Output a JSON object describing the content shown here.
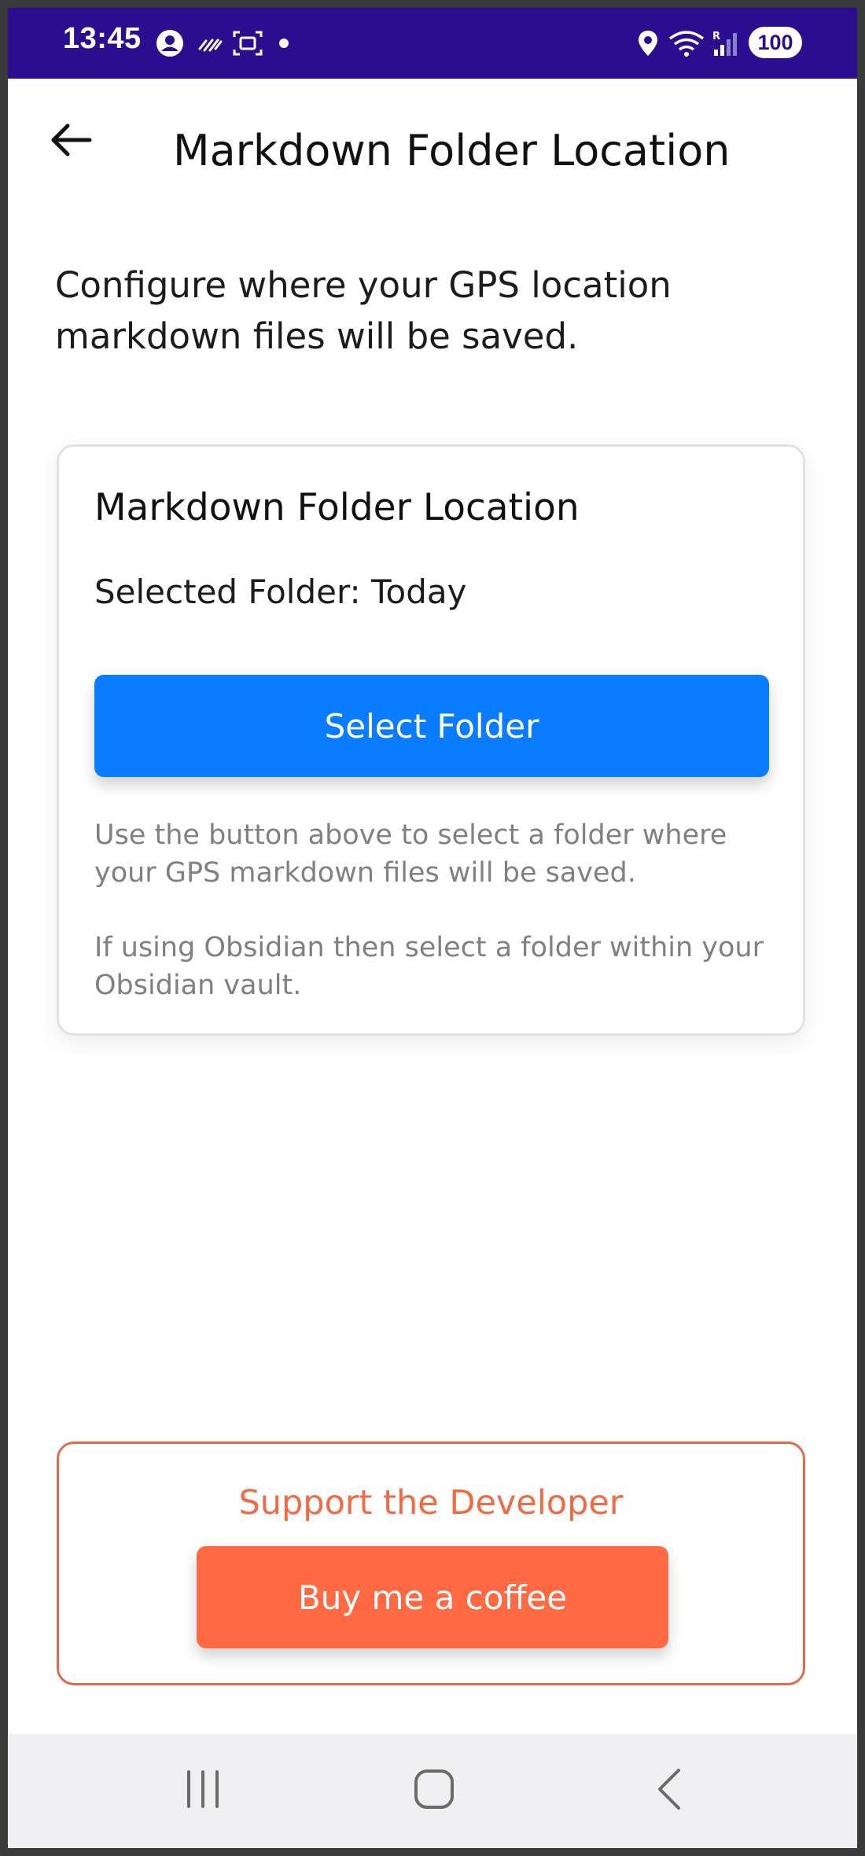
{
  "status_bar": {
    "time": "13:45",
    "battery": "100",
    "icons": [
      "account-icon",
      "data-saver-icon",
      "screenshot-icon",
      "dot-icon",
      "location-icon",
      "wifi-icon",
      "signal-icon"
    ],
    "background_color": "#2a0e8f"
  },
  "header": {
    "back_icon": "arrow-left-icon",
    "title": "Markdown Folder Location"
  },
  "intro": {
    "text": "Configure where your GPS location markdown files will be saved."
  },
  "folder_card": {
    "title": "Markdown Folder Location",
    "selected_folder": "Selected Folder: Today",
    "select_button_label": "Select Folder",
    "help_text_1": "Use the button above to select a folder where your GPS markdown files will be saved.",
    "help_text_2": "If using Obsidian then select a folder within your Obsidian vault.",
    "button_color": "#0a7cff"
  },
  "support_card": {
    "title": "Support the Developer",
    "button_label": "Buy me a coffee",
    "accent_color": "#ff6a44"
  },
  "nav_bar": {
    "icons": [
      "recent-apps-icon",
      "home-icon",
      "back-icon"
    ]
  }
}
